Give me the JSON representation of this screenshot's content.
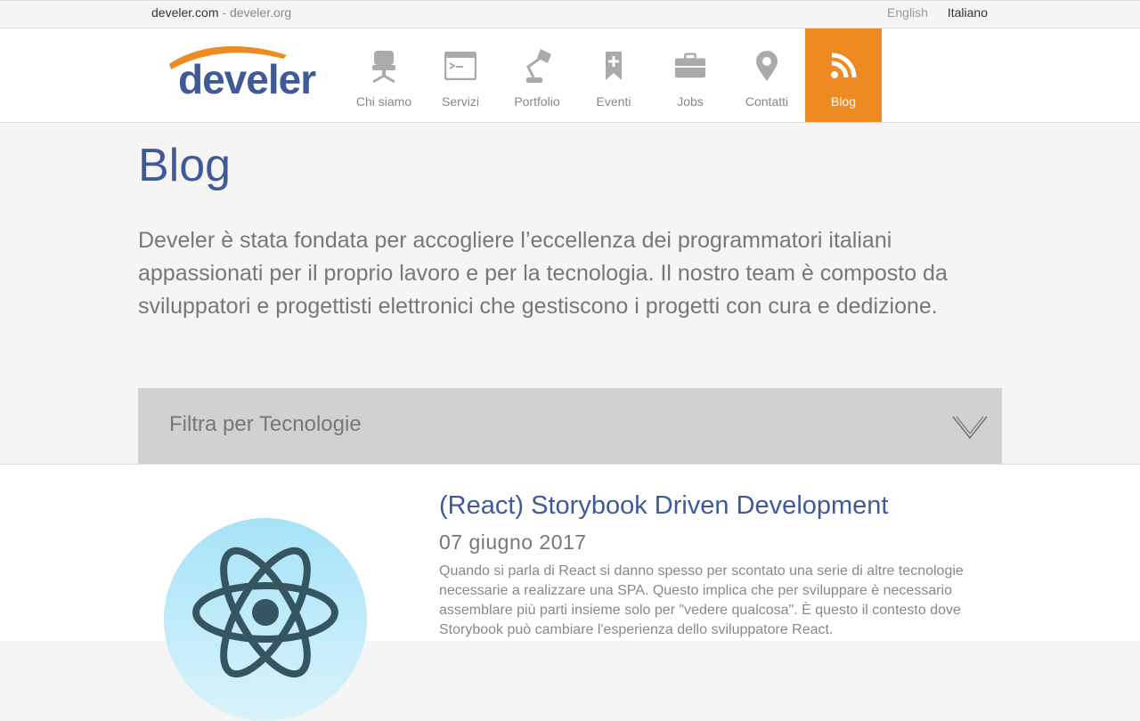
{
  "topbar": {
    "domain_primary": "develer.com",
    "separator": " - ",
    "domain_secondary": "develer.org",
    "languages": [
      "English",
      "Italiano"
    ]
  },
  "logo": {
    "text": "develer"
  },
  "nav": {
    "items": [
      {
        "label": "Chi siamo",
        "icon": "chair-icon"
      },
      {
        "label": "Servizi",
        "icon": "terminal-icon"
      },
      {
        "label": "Portfolio",
        "icon": "lamp-icon"
      },
      {
        "label": "Eventi",
        "icon": "bookmark-plus-icon"
      },
      {
        "label": "Jobs",
        "icon": "briefcase-icon"
      },
      {
        "label": "Contatti",
        "icon": "map-pin-icon"
      },
      {
        "label": "Blog",
        "icon": "rss-icon"
      }
    ],
    "active_color": "#ee8a22"
  },
  "page": {
    "title": "Blog",
    "intro": "Develer è stata fondata per accogliere l’eccellenza dei programmatori italiani appassionati per il proprio lavoro e per la tecnologia. Il nostro team è composto da sviluppatori e progettisti elettronici che gestiscono i progetti con cura e dedizione."
  },
  "filter": {
    "label": "Filtra per Tecnologie",
    "icon": "chevron-down-icon"
  },
  "posts": [
    {
      "title": "(React) Storybook Driven Development",
      "date": "07 giugno 2017",
      "excerpt": "Quando si parla di React si danno spesso per scontato una serie di altre tecnologie necessarie a realizzare una SPA. Questo implica che per sviluppare è necessario assemblare più parti insieme solo per \"vedere qualcosa\". È questo il contesto dove Storybook può cambiare l'esperienza dello sviluppatore React.",
      "image_icon": "react-atom-icon"
    }
  ],
  "colors": {
    "brand_blue": "#3f5a96",
    "brand_orange": "#ee8a22"
  }
}
